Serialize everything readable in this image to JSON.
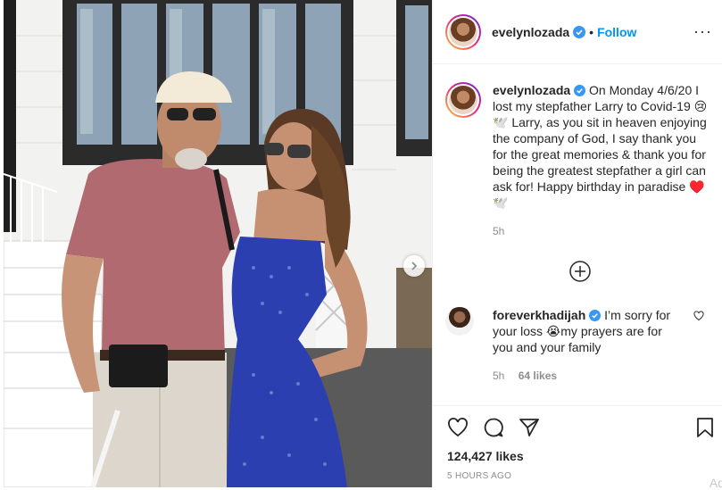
{
  "header": {
    "username": "evelynlozada",
    "separator": "•",
    "follow_label": "Follow",
    "more_label": "···"
  },
  "caption": {
    "username": "evelynlozada",
    "text": " On Monday 4/6/20 I lost my stepfather Larry to Covid-19 😢🕊️ Larry, as you sit in heaven enjoying the company of God, I say thank you for the great memories & thank you for being the greatest stepfather a girl can ask for! Happy birthday in paradise ♥️🕊️",
    "time": "5h"
  },
  "comment": {
    "username": "foreverkhadijah",
    "text": " I’m sorry for your loss 😭my prayers are for you and your family",
    "time": "5h",
    "likes": "64 likes"
  },
  "actions": {
    "likes": "124,427 likes",
    "posted": "5 HOURS AGO",
    "add_hint": "Ad"
  },
  "icons": [
    "heart-icon",
    "comment-icon",
    "share-icon",
    "bookmark-icon",
    "verified-icon",
    "plus-icon",
    "chevron-right-icon"
  ],
  "colors": {
    "accent": "#0095f6",
    "verified": "#3897f0",
    "border": "#efefef",
    "muted": "#8e8e8e"
  }
}
